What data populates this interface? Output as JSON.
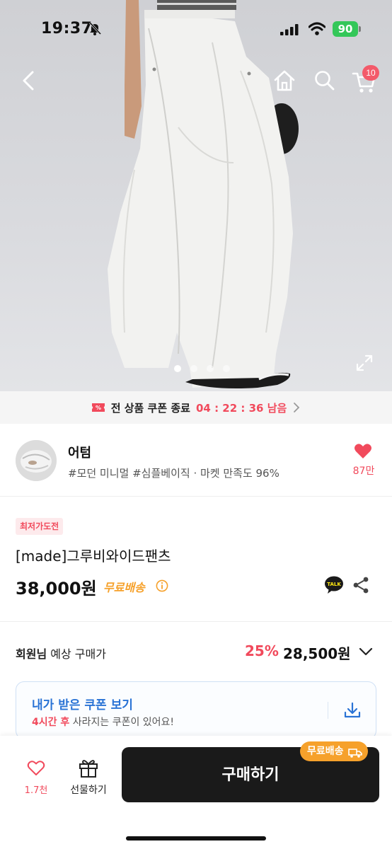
{
  "status_bar": {
    "time": "19:37",
    "battery": "90"
  },
  "header": {
    "cart_badge": "10"
  },
  "gallery": {
    "slide_count": 4,
    "active_slide": 1
  },
  "coupon_banner": {
    "title": "전 상품 쿠폰 종료",
    "countdown": "04 : 22 : 36 남음"
  },
  "store": {
    "name": "어텀",
    "tags": "#모던 미니멀 #심플베이직 · 마켓 만족도 96%",
    "likes": "87만"
  },
  "product": {
    "badge": "최저가도전",
    "name": "[made]그루비와이드팬츠",
    "price": "38,000원",
    "shipping": "무료배송"
  },
  "member_price": {
    "label_bold": "회원님",
    "label_rest": "예상 구매가",
    "discount": "25%",
    "price": "28,500원"
  },
  "coupon_box": {
    "title": "내가 받은 쿠폰 보기",
    "sub_highlight": "4시간 후",
    "sub_rest": "사라지는 쿠폰이 있어요!"
  },
  "bottom_bar": {
    "like_count": "1.7천",
    "gift_label": "선물하기",
    "buy_label": "구매하기",
    "shipping_pill": "무료배송"
  },
  "colors": {
    "accent_red": "#f14a5c",
    "accent_orange": "#f6a12b",
    "accent_blue": "#2a73d5",
    "battery_green": "#34c759"
  }
}
